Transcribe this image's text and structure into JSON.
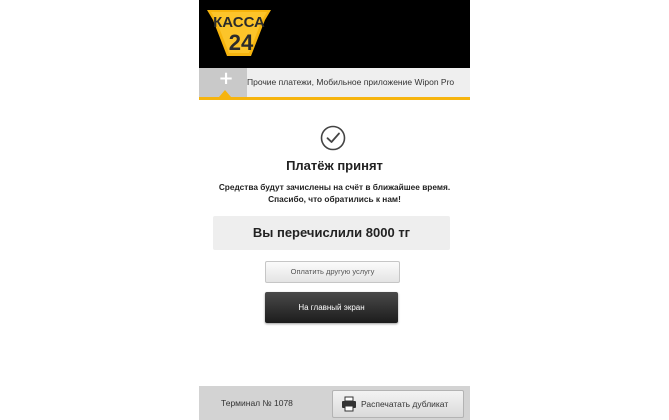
{
  "brand": {
    "logo_line1": "КАССА",
    "logo_line2": "24",
    "accent_color": "#f6b40e",
    "header_color": "#000000"
  },
  "breadcrumb": {
    "home_icon": "plus-icon",
    "home_glyph": "+",
    "path_text": "Прочие платежи, Мобильное приложение Wipon Pro"
  },
  "result": {
    "status_icon": "check-circle-icon",
    "title": "Платёж принят",
    "message_line1": "Средства будут зачислены на счёт в ближайшее время.",
    "message_line2": "Спасибо, что обратились к нам!",
    "amount_text": "Вы перечислили 8000 тг"
  },
  "actions": {
    "pay_other_label": "Оплатить другую услугу",
    "home_label": "На главный экран"
  },
  "footer": {
    "terminal_text": "Терминал № 1078",
    "print_icon": "printer-icon",
    "print_label": "Распечатать дубликат"
  }
}
